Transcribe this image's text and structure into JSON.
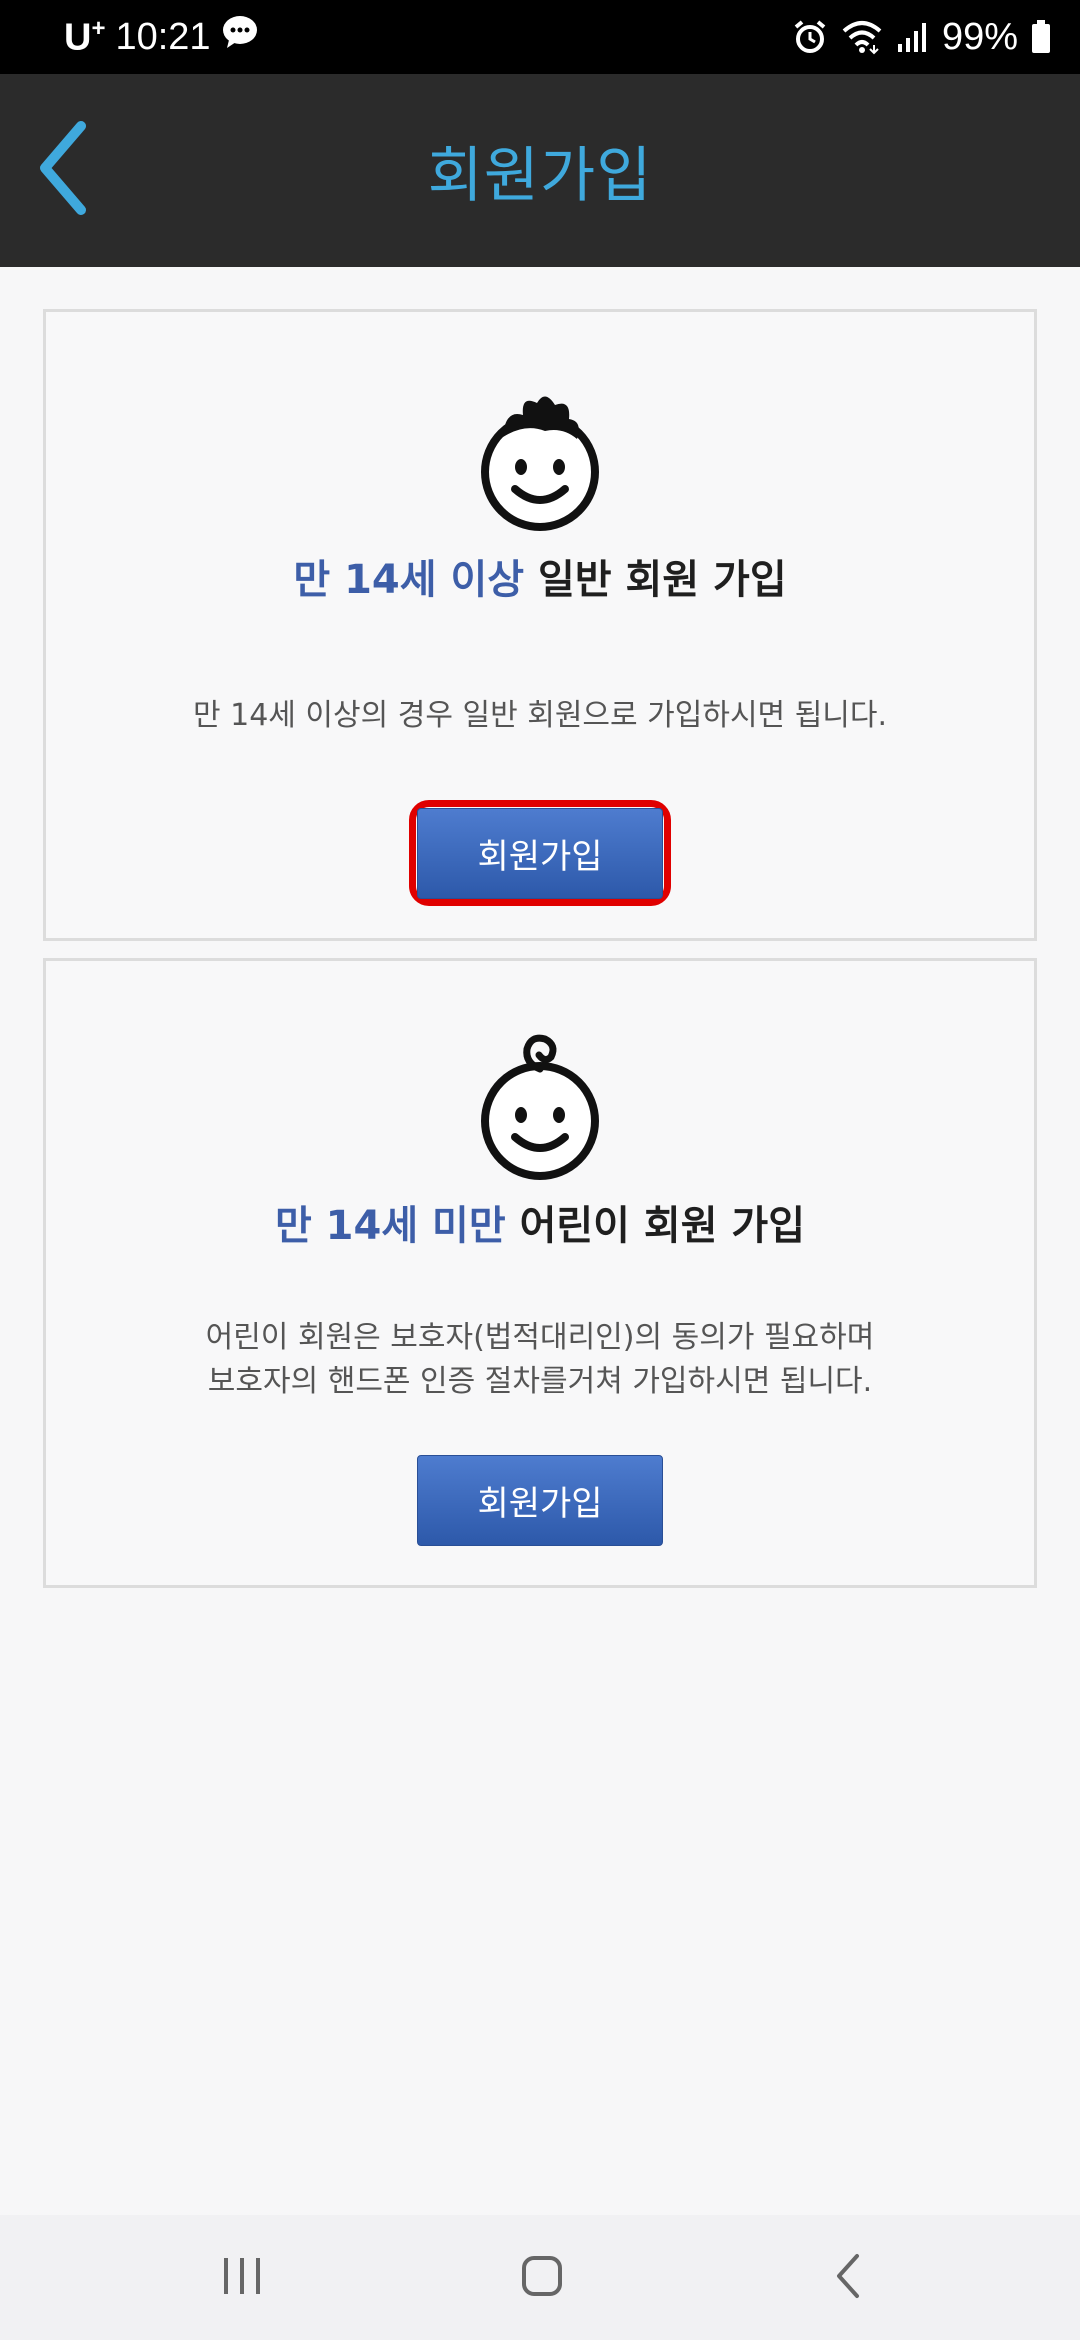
{
  "status_bar": {
    "carrier": "U",
    "carrier_sup": "+",
    "time": "10:21",
    "battery": "99%",
    "icons": [
      "chat-icon",
      "alarm-icon",
      "wifi-icon",
      "signal-icon",
      "battery-icon"
    ]
  },
  "header": {
    "title": "회원가입",
    "back_icon": "chevron-left-icon",
    "accent_color": "#3fa9dd"
  },
  "adult_card": {
    "icon": "boy-face-icon",
    "heading_accent": "만 14세 이상",
    "heading_rest": " 일반 회원 가입",
    "description": "만 14세 이상의 경우 일반 회원으로 가입하시면 됩니다.",
    "button_label": "회원가입"
  },
  "child_card": {
    "icon": "baby-face-icon",
    "heading_accent": "만 14세 미만",
    "heading_rest": " 어린이 회원 가입",
    "description_line1": "어린이 회원은 보호자(법적대리인)의 동의가 필요하며",
    "description_line2": "보호자의 핸드폰 인증 절차를거쳐 가입하시면 됩니다.",
    "button_label": "회원가입"
  },
  "nav_bar": {
    "icons": [
      "recents-icon",
      "home-icon",
      "back-icon"
    ]
  }
}
